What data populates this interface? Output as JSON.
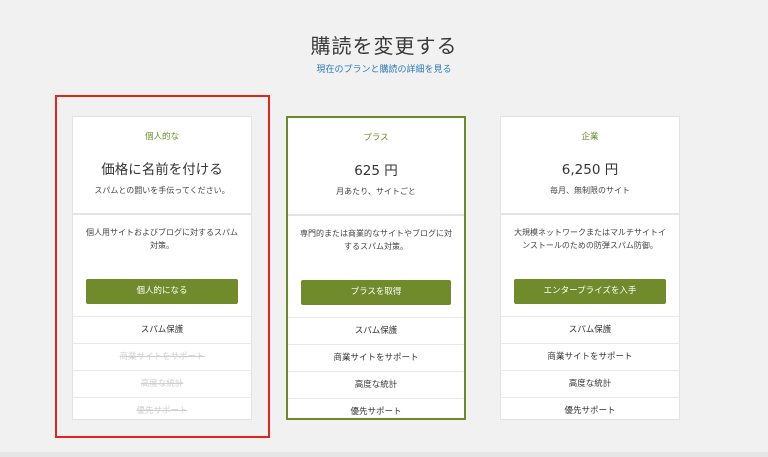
{
  "header": {
    "title": "購読を変更する",
    "link": "現在のプランと購読の詳細を見る"
  },
  "plans": [
    {
      "name": "個人的な",
      "price": "価格に名前を付ける",
      "price_sub": "スパムとの闘いを手伝ってください。",
      "description": "個人用サイトおよびブログに対するスパム対策。",
      "button": "個人的になる",
      "features": [
        "スパム保護",
        "商業サイトをサポート",
        "高度な統計",
        "優先サポート"
      ]
    },
    {
      "name": "プラス",
      "price": "625 円",
      "price_sub": "月あたり、サイトごと",
      "description": "専門的または商業的なサイトやブログに対するスパム対策。",
      "button": "プラスを取得",
      "features": [
        "スパム保護",
        "商業サイトをサポート",
        "高度な統計",
        "優先サポート"
      ]
    },
    {
      "name": "企業",
      "price": "6,250 円",
      "price_sub": "毎月、無制限のサイト",
      "description": "大規模ネットワークまたはマルチサイトインストールのための防弾スパム防御。",
      "button": "エンタープライズを入手",
      "features": [
        "スパム保護",
        "商業サイトをサポート",
        "高度な統計",
        "優先サポート"
      ]
    }
  ],
  "colors": {
    "accent": "#6f8b2c",
    "link": "#2d7ab8",
    "highlight": "#e52420"
  }
}
